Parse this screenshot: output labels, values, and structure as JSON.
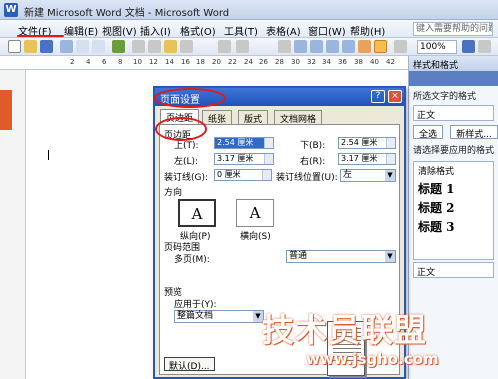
{
  "window": {
    "title": "新建 Microsoft Word 文档 - Microsoft Word",
    "app_icon": "word-icon",
    "accent": "#2b5fb4"
  },
  "menu": [
    "文件(F)",
    "编辑(E)",
    "视图(V)",
    "插入(I)",
    "格式(O)",
    "工具(T)",
    "表格(A)",
    "窗口(W)",
    "帮助(H)"
  ],
  "help_placeholder": "键入需要帮助的问题",
  "toolbar": {
    "zoom": "100%"
  },
  "ruler": [
    "2",
    "4",
    "6",
    "8",
    "10",
    "12",
    "14",
    "16",
    "18",
    "20",
    "22",
    "24",
    "26",
    "28",
    "30",
    "32",
    "34",
    "36",
    "38",
    "40",
    "42"
  ],
  "taskpane": {
    "title": "样式和格式",
    "selected_label": "所选文字的格式",
    "selected_value": "正文",
    "select_all": "全选",
    "new_style": "新样式...",
    "apply_label": "请选择要应用的格式",
    "items": [
      "清除格式",
      "标题 1",
      "标题 2",
      "标题 3"
    ],
    "normal": "正文"
  },
  "dialog": {
    "title": "页面设置",
    "tabs": [
      "页边距",
      "纸张",
      "版式",
      "文档网格"
    ],
    "section_margins": "页边距",
    "top_label": "上(T):",
    "top_value": "2.54 厘米",
    "bottom_label": "下(B):",
    "bottom_value": "2.54 厘米",
    "left_label": "左(L):",
    "left_value": "3.17 厘米",
    "right_label": "右(R):",
    "right_value": "3.17 厘米",
    "gutter_label": "装订线(G):",
    "gutter_value": "0 厘米",
    "gutter_pos_label": "装订线位置(U):",
    "gutter_pos_value": "左",
    "orientation_label": "方向",
    "portrait": "纵向(P)",
    "landscape": "横向(S)",
    "pages_label": "页码范围",
    "multi_pages_label": "多页(M):",
    "multi_pages_value": "普通",
    "preview_label": "预览",
    "apply_to_label": "应用于(Y):",
    "apply_to_value": "整篇文档",
    "default_button": "默认(D)..."
  },
  "watermark": {
    "brand": "技术员联盟",
    "url": "www.jsgho.com"
  }
}
